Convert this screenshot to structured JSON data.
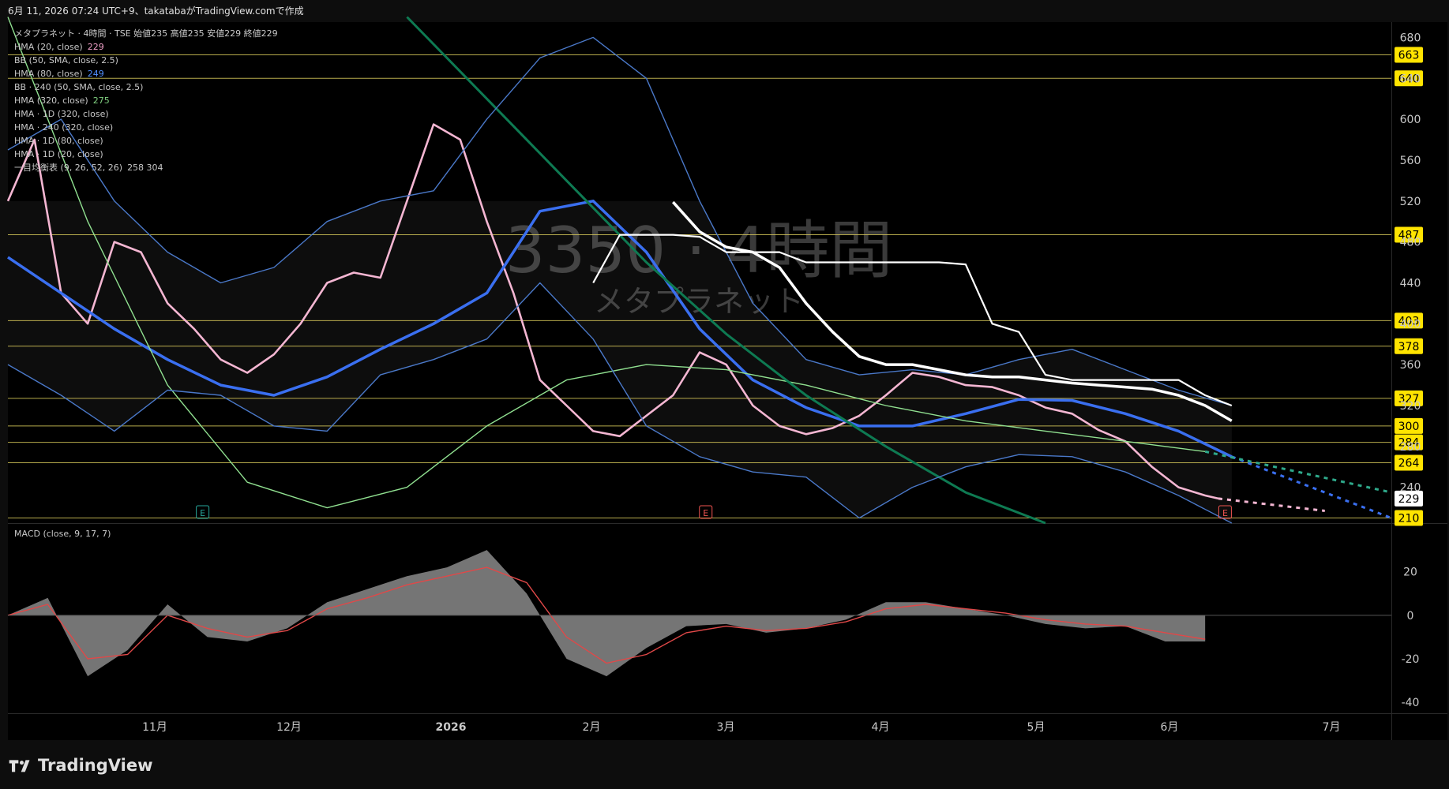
{
  "header": {
    "text": "6月 11, 2026 07:24 UTC+9、takatabaがTradingView.comで作成"
  },
  "legend": [
    {
      "label": "メタプラネット · 4時間 · TSE  始値235  高値235  安値229  終値229",
      "value": "",
      "color": "#e0e0e0"
    },
    {
      "label": "HMA (20, close)",
      "value": "229",
      "color": "#f0a0c8"
    },
    {
      "label": "BB (50, SMA, close, 2.5)",
      "value": "",
      "color": "#c8c8c8"
    },
    {
      "label": "HMA (80, close)",
      "value": "249",
      "color": "#5090ff"
    },
    {
      "label": "BB · 240 (50, SMA, close, 2.5)",
      "value": "",
      "color": "#c8c8c8"
    },
    {
      "label": "HMA (320, close)",
      "value": "275",
      "color": "#80d080"
    },
    {
      "label": "HMA · 1D (320, close)",
      "value": "",
      "color": "#c8c8c8"
    },
    {
      "label": "HMA · 240 (320, close)",
      "value": "",
      "color": "#c8c8c8"
    },
    {
      "label": "HMA · 1D (80, close)",
      "value": "",
      "color": "#c8c8c8"
    },
    {
      "label": "HMA · 1D (20, close)",
      "value": "",
      "color": "#c8c8c8"
    },
    {
      "label": "一目均衡表 (9, 26, 52, 26)",
      "value": "258  304",
      "color": "#c8c8c8"
    }
  ],
  "watermark": {
    "ticker": "3350 · 4時間",
    "name": "メタプラネット"
  },
  "macd": {
    "title": "MACD (close, 9, 17, 7)"
  },
  "footer": {
    "brand": "TradingView"
  },
  "chart_data": {
    "type": "line",
    "title": "メタプラネット · 4時間 · TSE",
    "ohlc_last": {
      "open": 235,
      "high": 235,
      "low": 229,
      "close": 229
    },
    "x_ticks": [
      "11月",
      "12月",
      "2026",
      "2月",
      "3月",
      "4月",
      "5月",
      "6月",
      "7月"
    ],
    "price_axis": {
      "ticks": [
        240,
        280,
        320,
        360,
        400,
        440,
        480,
        520,
        560,
        600,
        640,
        680
      ],
      "ylim": [
        205,
        695
      ]
    },
    "horizontal_levels": [
      {
        "value": 663,
        "label": "663"
      },
      {
        "value": 640,
        "label": "640"
      },
      {
        "value": 487,
        "label": "487"
      },
      {
        "value": 403,
        "label": "403"
      },
      {
        "value": 378,
        "label": "378"
      },
      {
        "value": 327,
        "label": "327"
      },
      {
        "value": 300,
        "label": "300"
      },
      {
        "value": 284,
        "label": "284"
      },
      {
        "value": 264,
        "label": "264"
      },
      {
        "value": 210,
        "label": "210"
      }
    ],
    "last_price_label": "229",
    "earnings_markers": [
      {
        "date_index": 12,
        "label": "E",
        "color": "#26a69a"
      },
      {
        "date_index": 43,
        "label": "E",
        "color": "#ef5350"
      },
      {
        "date_index": 75,
        "label": "E",
        "color": "#ef5350"
      }
    ],
    "series": [
      {
        "name": "HMA (20, close)",
        "color": "#f4b6d2",
        "x": [
          0,
          2,
          4,
          6,
          8,
          10,
          12,
          14,
          16,
          18,
          20,
          22,
          24,
          26,
          28,
          30,
          32,
          34,
          36,
          38,
          40,
          42,
          44,
          46,
          48,
          50,
          52,
          54,
          56,
          58,
          60,
          62,
          64,
          66,
          68,
          70,
          72,
          74,
          76,
          78,
          80,
          82,
          84,
          86,
          88,
          90,
          91
        ],
        "values": [
          520,
          580,
          430,
          400,
          480,
          470,
          420,
          395,
          365,
          352,
          370,
          400,
          440,
          450,
          445,
          520,
          595,
          580,
          500,
          430,
          345,
          320,
          295,
          290,
          310,
          330,
          372,
          360,
          320,
          300,
          292,
          298,
          310,
          330,
          352,
          348,
          340,
          338,
          330,
          318,
          312,
          296,
          285,
          260,
          240,
          232,
          229
        ]
      },
      {
        "name": "HMA (80, close)",
        "color": "#3a6ff0",
        "x": [
          0,
          4,
          8,
          12,
          16,
          20,
          24,
          28,
          32,
          36,
          40,
          44,
          48,
          52,
          56,
          60,
          64,
          68,
          72,
          76,
          80,
          84,
          88,
          92
        ],
        "values": [
          465,
          430,
          395,
          365,
          340,
          330,
          348,
          375,
          400,
          430,
          510,
          520,
          470,
          395,
          345,
          318,
          300,
          300,
          312,
          326,
          325,
          312,
          295,
          270
        ]
      },
      {
        "name": "HMA (320, close)",
        "color": "#90e090",
        "x": [
          0,
          6,
          12,
          18,
          24,
          30,
          36,
          42,
          48,
          54,
          60,
          66,
          72,
          78,
          84,
          90
        ],
        "values": [
          700,
          500,
          340,
          245,
          220,
          240,
          300,
          345,
          360,
          355,
          340,
          320,
          305,
          295,
          285,
          275
        ]
      },
      {
        "name": "HMA · 240 (320, close)",
        "color": "#0e7a52",
        "x": [
          30,
          36,
          42,
          48,
          54,
          60,
          66,
          72,
          78
        ],
        "values": [
          700,
          620,
          540,
          460,
          390,
          330,
          280,
          235,
          205
        ]
      },
      {
        "name": "BB upper",
        "color": "#4a78c8",
        "x": [
          0,
          4,
          8,
          12,
          16,
          20,
          24,
          28,
          32,
          36,
          40,
          44,
          48,
          52,
          56,
          60,
          64,
          68,
          72,
          76,
          80,
          84,
          88,
          92
        ],
        "values": [
          570,
          600,
          520,
          470,
          440,
          455,
          500,
          520,
          530,
          600,
          660,
          680,
          640,
          520,
          420,
          365,
          350,
          355,
          350,
          365,
          375,
          355,
          335,
          320
        ]
      },
      {
        "name": "BB lower",
        "color": "#4a78c8",
        "x": [
          0,
          4,
          8,
          12,
          16,
          20,
          24,
          28,
          32,
          36,
          40,
          44,
          48,
          52,
          56,
          60,
          64,
          68,
          72,
          76,
          80,
          84,
          88,
          92
        ],
        "values": [
          360,
          330,
          295,
          335,
          330,
          300,
          295,
          350,
          365,
          385,
          440,
          385,
          300,
          270,
          255,
          250,
          210,
          240,
          260,
          272,
          270,
          255,
          232,
          205
        ]
      },
      {
        "name": "HMA · 1D (80, close)",
        "color": "#ffffff",
        "x": [
          50,
          52,
          54,
          56,
          58,
          60,
          62,
          64,
          66,
          68,
          70,
          72,
          74,
          76,
          78,
          80,
          82,
          84,
          86,
          88,
          90,
          92
        ],
        "values": [
          519,
          490,
          475,
          470,
          455,
          420,
          392,
          368,
          360,
          360,
          355,
          350,
          348,
          348,
          345,
          342,
          340,
          338,
          336,
          330,
          320,
          305
        ]
      },
      {
        "name": "HMA · 1D (20, close)",
        "color": "#ffffff",
        "x": [
          44,
          46,
          48,
          50,
          52,
          54,
          56,
          58,
          60,
          62,
          64,
          66,
          68,
          70,
          72,
          74,
          76,
          78,
          80,
          82,
          84,
          86,
          88,
          90,
          92
        ],
        "values": [
          440,
          487,
          487,
          487,
          485,
          470,
          470,
          470,
          460,
          460,
          460,
          460,
          460,
          460,
          458,
          400,
          392,
          350,
          345,
          345,
          345,
          345,
          345,
          330,
          320
        ]
      }
    ],
    "macd": {
      "ylim": [
        -45,
        38
      ],
      "ticks": [
        20,
        0,
        -20,
        -40
      ],
      "hist_x": [
        0,
        3,
        6,
        9,
        12,
        15,
        18,
        21,
        24,
        27,
        30,
        33,
        36,
        39,
        42,
        45,
        48,
        51,
        54,
        57,
        60,
        63,
        66,
        69,
        72,
        75,
        78,
        81,
        84,
        87,
        90
      ],
      "hist": [
        0,
        8,
        -28,
        -16,
        5,
        -10,
        -12,
        -6,
        6,
        12,
        18,
        22,
        30,
        10,
        -20,
        -28,
        -15,
        -5,
        -4,
        -8,
        -6,
        -2,
        6,
        6,
        3,
        0,
        -4,
        -6,
        -5,
        -12,
        -12
      ],
      "signal": [
        0,
        5,
        -20,
        -18,
        0,
        -6,
        -10,
        -7,
        3,
        8,
        14,
        18,
        22,
        15,
        -10,
        -22,
        -18,
        -8,
        -5,
        -7,
        -6,
        -3,
        3,
        5,
        3,
        1,
        -2,
        -4,
        -5,
        -8,
        -11
      ]
    }
  }
}
